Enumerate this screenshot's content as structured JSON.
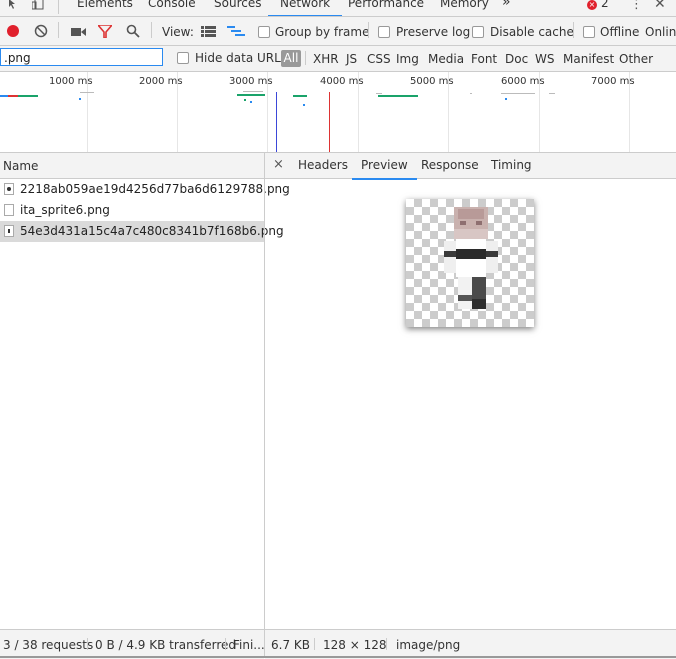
{
  "tabs": {
    "elements": "Elements",
    "console": "Console",
    "sources": "Sources",
    "network": "Network",
    "performance": "Performance",
    "memory": "Memory",
    "more": "»",
    "error_count": "2"
  },
  "toolbar": {
    "view_label": "View:",
    "group_by_frame": "Group by frame",
    "preserve_log": "Preserve log",
    "disable_cache": "Disable cache",
    "offline": "Offline",
    "online": "Onlin"
  },
  "filter": {
    "value": ".png",
    "hide_data_urls": "Hide data URLs",
    "types": [
      "All",
      "XHR",
      "JS",
      "CSS",
      "Img",
      "Media",
      "Font",
      "Doc",
      "WS",
      "Manifest",
      "Other"
    ]
  },
  "overview": {
    "labels": [
      "1000 ms",
      "2000 ms",
      "3000 ms",
      "4000 ms",
      "5000 ms",
      "6000 ms",
      "7000 ms"
    ]
  },
  "list": {
    "header": "Name",
    "rows": [
      "2218ab059ae19d4256d77ba6d6129788.png",
      "ita_sprite6.png",
      "54e3d431a15c4a7c480c8341b7f168b6.png"
    ]
  },
  "detail": {
    "close": "×",
    "tabs": [
      "Headers",
      "Preview",
      "Response",
      "Timing"
    ]
  },
  "status": {
    "requests": "3 / 38 requests",
    "transferred": "0 B / 4.9 KB transferred",
    "finish": "Fini...",
    "size": "6.7 KB",
    "dimensions": "128 × 128",
    "mime": "image/png"
  },
  "colors": {
    "accent": "#2a8af0",
    "record": "#e0202c",
    "filter_active": "#d33"
  }
}
